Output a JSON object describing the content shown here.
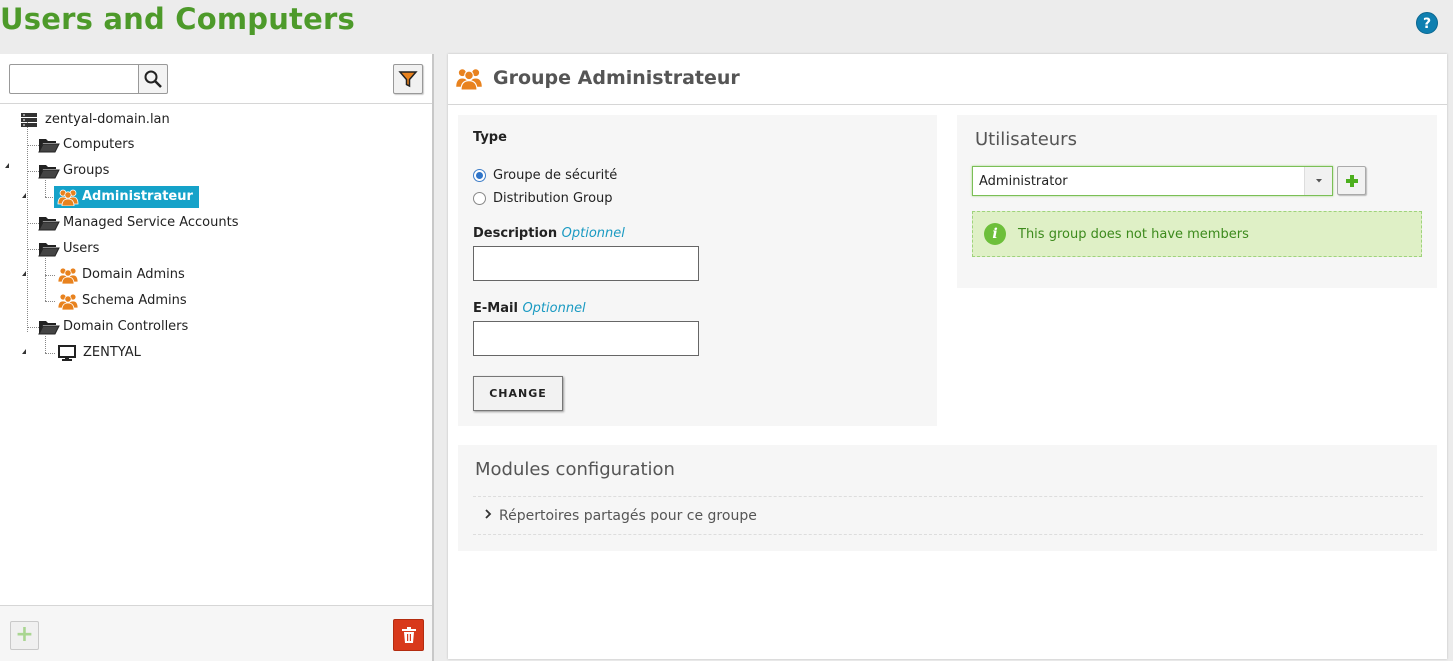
{
  "page": {
    "title": "Users and Computers",
    "help_icon": "?"
  },
  "search": {
    "placeholder": "",
    "value": ""
  },
  "tree": {
    "root": {
      "label": "zentyal-domain.lan",
      "icon": "server-icon"
    },
    "items": [
      {
        "label": "Computers",
        "icon": "folder-open-icon"
      },
      {
        "label": "Groups",
        "icon": "folder-open-icon"
      },
      {
        "label": "Administrateur",
        "icon": "group-icon",
        "selected": true
      },
      {
        "label": "Managed Service Accounts",
        "icon": "folder-open-icon"
      },
      {
        "label": "Users",
        "icon": "folder-open-icon"
      },
      {
        "label": "Domain Admins",
        "icon": "group-icon"
      },
      {
        "label": "Schema Admins",
        "icon": "group-icon"
      },
      {
        "label": "Domain Controllers",
        "icon": "folder-open-icon"
      },
      {
        "label": "ZENTYAL",
        "icon": "computer-icon"
      }
    ]
  },
  "footer": {
    "add_label": "+"
  },
  "group": {
    "title": "Groupe Administrateur",
    "type_label": "Type",
    "type_options": [
      "Groupe de sécurité",
      "Distribution Group"
    ],
    "type_selected": "Groupe de sécurité",
    "description_label": "Description",
    "description_optional": "Optionnel",
    "description_value": "",
    "email_label": "E-Mail",
    "email_optional": "Optionnel",
    "email_value": "",
    "change_label": "CHANGE"
  },
  "members": {
    "title": "Utilisateurs",
    "select_value": "Administrator",
    "note": "This group does not have members"
  },
  "modules": {
    "title": "Modules configuration",
    "rows": [
      "Répertoires partagés pour ce groupe"
    ]
  },
  "colors": {
    "title_green": "#4d9a2a",
    "selected_blue": "#15a2c9",
    "group_orange": "#e8821e",
    "delete_red": "#d8391b",
    "note_green": "#dff0c6"
  }
}
